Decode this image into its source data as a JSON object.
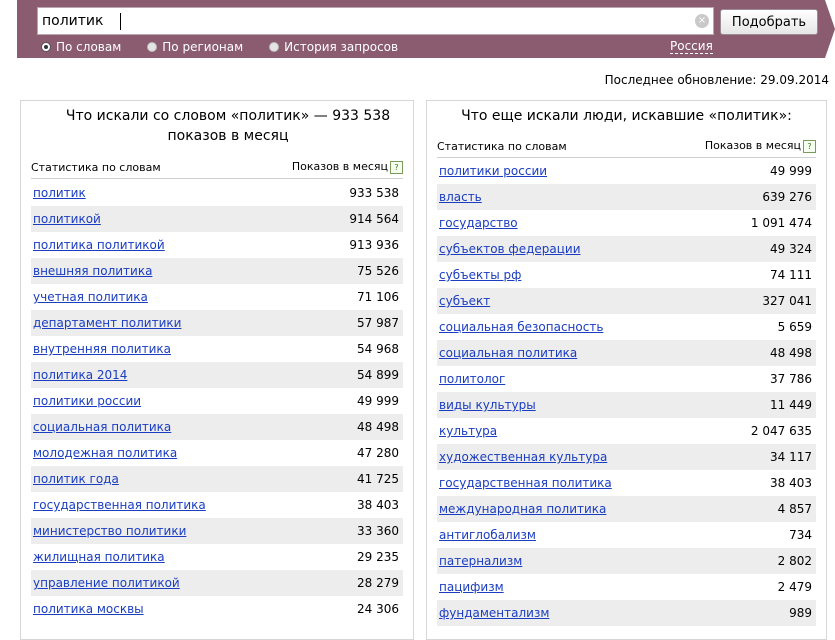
{
  "search": {
    "query": "политик",
    "button_label": "Подобрать",
    "clear_symbol": "×"
  },
  "modes": [
    {
      "label": "По словам",
      "selected": true
    },
    {
      "label": "По регионам",
      "selected": false
    },
    {
      "label": "История запросов",
      "selected": false
    }
  ],
  "region": "Россия",
  "update_text": "Последнее обновление: 29.09.2014",
  "left_panel": {
    "title": "Что искали со словом «политик» — 933 538 показов в месяц",
    "col_word": "Статистика по словам",
    "col_count": "Показов в месяц",
    "help_symbol": "?",
    "rows": [
      {
        "phrase": "политик",
        "count": "933 538"
      },
      {
        "phrase": "политикой",
        "count": "914 564"
      },
      {
        "phrase": "политика политикой",
        "count": "913 936"
      },
      {
        "phrase": "внешняя политика",
        "count": "75 526"
      },
      {
        "phrase": "учетная политика",
        "count": "71 106"
      },
      {
        "phrase": "департамент политики",
        "count": "57 987"
      },
      {
        "phrase": "внутренняя политика",
        "count": "54 968"
      },
      {
        "phrase": "политика 2014",
        "count": "54 899"
      },
      {
        "phrase": "политики россии",
        "count": "49 999"
      },
      {
        "phrase": "социальная политика",
        "count": "48 498"
      },
      {
        "phrase": "молодежная политика",
        "count": "47 280"
      },
      {
        "phrase": "политик года",
        "count": "41 725"
      },
      {
        "phrase": "государственная политика",
        "count": "38 403"
      },
      {
        "phrase": "министерство политики",
        "count": "33 360"
      },
      {
        "phrase": "жилищная политика",
        "count": "29 235"
      },
      {
        "phrase": "управление политикой",
        "count": "28 279"
      },
      {
        "phrase": "политика москвы",
        "count": "24 306"
      }
    ]
  },
  "right_panel": {
    "title": "Что еще искали люди, искавшие «политик»:",
    "col_word": "Статистика по словам",
    "col_count": "Показов в месяц",
    "help_symbol": "?",
    "rows": [
      {
        "phrase": "политики россии",
        "count": "49 999"
      },
      {
        "phrase": "власть",
        "count": "639 276"
      },
      {
        "phrase": "государство",
        "count": "1 091 474"
      },
      {
        "phrase": "субъектов федерации",
        "count": "49 324"
      },
      {
        "phrase": "субъекты рф",
        "count": "74 111"
      },
      {
        "phrase": "субъект",
        "count": "327 041"
      },
      {
        "phrase": "социальная безопасность",
        "count": "5 659"
      },
      {
        "phrase": "социальная политика",
        "count": "48 498"
      },
      {
        "phrase": "политолог",
        "count": "37 786"
      },
      {
        "phrase": "виды культуры",
        "count": "11 449"
      },
      {
        "phrase": "культура",
        "count": "2 047 635"
      },
      {
        "phrase": "художественная культура",
        "count": "34 117"
      },
      {
        "phrase": "государственная политика",
        "count": "38 403"
      },
      {
        "phrase": "международная политика",
        "count": "4 857"
      },
      {
        "phrase": "антиглобализм",
        "count": "734"
      },
      {
        "phrase": "патернализм",
        "count": "2 802"
      },
      {
        "phrase": "пацифизм",
        "count": "2 479"
      },
      {
        "phrase": "фундаментализм",
        "count": "989"
      }
    ]
  }
}
